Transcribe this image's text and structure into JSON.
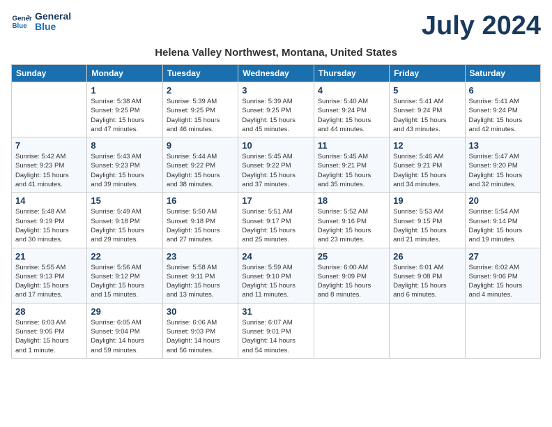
{
  "logo": {
    "line1": "General",
    "line2": "Blue"
  },
  "title": "July 2024",
  "subtitle": "Helena Valley Northwest, Montana, United States",
  "header": {
    "days": [
      "Sunday",
      "Monday",
      "Tuesday",
      "Wednesday",
      "Thursday",
      "Friday",
      "Saturday"
    ]
  },
  "weeks": [
    [
      {
        "day": "",
        "info": ""
      },
      {
        "day": "1",
        "info": "Sunrise: 5:38 AM\nSunset: 9:25 PM\nDaylight: 15 hours\nand 47 minutes."
      },
      {
        "day": "2",
        "info": "Sunrise: 5:39 AM\nSunset: 9:25 PM\nDaylight: 15 hours\nand 46 minutes."
      },
      {
        "day": "3",
        "info": "Sunrise: 5:39 AM\nSunset: 9:25 PM\nDaylight: 15 hours\nand 45 minutes."
      },
      {
        "day": "4",
        "info": "Sunrise: 5:40 AM\nSunset: 9:24 PM\nDaylight: 15 hours\nand 44 minutes."
      },
      {
        "day": "5",
        "info": "Sunrise: 5:41 AM\nSunset: 9:24 PM\nDaylight: 15 hours\nand 43 minutes."
      },
      {
        "day": "6",
        "info": "Sunrise: 5:41 AM\nSunset: 9:24 PM\nDaylight: 15 hours\nand 42 minutes."
      }
    ],
    [
      {
        "day": "7",
        "info": "Sunrise: 5:42 AM\nSunset: 9:23 PM\nDaylight: 15 hours\nand 41 minutes."
      },
      {
        "day": "8",
        "info": "Sunrise: 5:43 AM\nSunset: 9:23 PM\nDaylight: 15 hours\nand 39 minutes."
      },
      {
        "day": "9",
        "info": "Sunrise: 5:44 AM\nSunset: 9:22 PM\nDaylight: 15 hours\nand 38 minutes."
      },
      {
        "day": "10",
        "info": "Sunrise: 5:45 AM\nSunset: 9:22 PM\nDaylight: 15 hours\nand 37 minutes."
      },
      {
        "day": "11",
        "info": "Sunrise: 5:45 AM\nSunset: 9:21 PM\nDaylight: 15 hours\nand 35 minutes."
      },
      {
        "day": "12",
        "info": "Sunrise: 5:46 AM\nSunset: 9:21 PM\nDaylight: 15 hours\nand 34 minutes."
      },
      {
        "day": "13",
        "info": "Sunrise: 5:47 AM\nSunset: 9:20 PM\nDaylight: 15 hours\nand 32 minutes."
      }
    ],
    [
      {
        "day": "14",
        "info": "Sunrise: 5:48 AM\nSunset: 9:19 PM\nDaylight: 15 hours\nand 30 minutes."
      },
      {
        "day": "15",
        "info": "Sunrise: 5:49 AM\nSunset: 9:18 PM\nDaylight: 15 hours\nand 29 minutes."
      },
      {
        "day": "16",
        "info": "Sunrise: 5:50 AM\nSunset: 9:18 PM\nDaylight: 15 hours\nand 27 minutes."
      },
      {
        "day": "17",
        "info": "Sunrise: 5:51 AM\nSunset: 9:17 PM\nDaylight: 15 hours\nand 25 minutes."
      },
      {
        "day": "18",
        "info": "Sunrise: 5:52 AM\nSunset: 9:16 PM\nDaylight: 15 hours\nand 23 minutes."
      },
      {
        "day": "19",
        "info": "Sunrise: 5:53 AM\nSunset: 9:15 PM\nDaylight: 15 hours\nand 21 minutes."
      },
      {
        "day": "20",
        "info": "Sunrise: 5:54 AM\nSunset: 9:14 PM\nDaylight: 15 hours\nand 19 minutes."
      }
    ],
    [
      {
        "day": "21",
        "info": "Sunrise: 5:55 AM\nSunset: 9:13 PM\nDaylight: 15 hours\nand 17 minutes."
      },
      {
        "day": "22",
        "info": "Sunrise: 5:56 AM\nSunset: 9:12 PM\nDaylight: 15 hours\nand 15 minutes."
      },
      {
        "day": "23",
        "info": "Sunrise: 5:58 AM\nSunset: 9:11 PM\nDaylight: 15 hours\nand 13 minutes."
      },
      {
        "day": "24",
        "info": "Sunrise: 5:59 AM\nSunset: 9:10 PM\nDaylight: 15 hours\nand 11 minutes."
      },
      {
        "day": "25",
        "info": "Sunrise: 6:00 AM\nSunset: 9:09 PM\nDaylight: 15 hours\nand 8 minutes."
      },
      {
        "day": "26",
        "info": "Sunrise: 6:01 AM\nSunset: 9:08 PM\nDaylight: 15 hours\nand 6 minutes."
      },
      {
        "day": "27",
        "info": "Sunrise: 6:02 AM\nSunset: 9:06 PM\nDaylight: 15 hours\nand 4 minutes."
      }
    ],
    [
      {
        "day": "28",
        "info": "Sunrise: 6:03 AM\nSunset: 9:05 PM\nDaylight: 15 hours\nand 1 minute."
      },
      {
        "day": "29",
        "info": "Sunrise: 6:05 AM\nSunset: 9:04 PM\nDaylight: 14 hours\nand 59 minutes."
      },
      {
        "day": "30",
        "info": "Sunrise: 6:06 AM\nSunset: 9:03 PM\nDaylight: 14 hours\nand 56 minutes."
      },
      {
        "day": "31",
        "info": "Sunrise: 6:07 AM\nSunset: 9:01 PM\nDaylight: 14 hours\nand 54 minutes."
      },
      {
        "day": "",
        "info": ""
      },
      {
        "day": "",
        "info": ""
      },
      {
        "day": "",
        "info": ""
      }
    ]
  ]
}
